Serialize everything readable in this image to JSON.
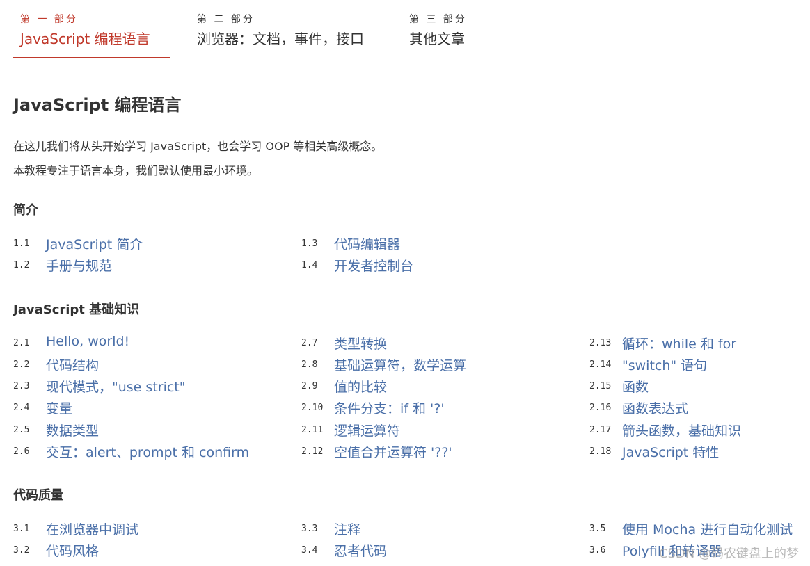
{
  "tabs": [
    {
      "kicker": "第 一 部分",
      "title": "JavaScript 编程语言",
      "active": true
    },
    {
      "kicker": "第 二 部分",
      "title": "浏览器：文档，事件，接口",
      "active": false
    },
    {
      "kicker": "第 三 部分",
      "title": "其他文章",
      "active": false
    }
  ],
  "page": {
    "title": "JavaScript 编程语言",
    "intro": [
      "在这儿我们将从头开始学习 JavaScript，也会学习 OOP 等相关高级概念。",
      "本教程专注于语言本身，我们默认使用最小环境。"
    ]
  },
  "sections": [
    {
      "heading": "简介",
      "items": [
        {
          "num": "1.1",
          "label": "JavaScript 简介"
        },
        {
          "num": "1.2",
          "label": "手册与规范"
        },
        {
          "num": "1.3",
          "label": "代码编辑器"
        },
        {
          "num": "1.4",
          "label": "开发者控制台"
        }
      ]
    },
    {
      "heading": "JavaScript 基础知识",
      "items": [
        {
          "num": "2.1",
          "label": "Hello, world!"
        },
        {
          "num": "2.2",
          "label": "代码结构"
        },
        {
          "num": "2.3",
          "label": "现代模式，\"use strict\""
        },
        {
          "num": "2.4",
          "label": "变量"
        },
        {
          "num": "2.5",
          "label": "数据类型"
        },
        {
          "num": "2.6",
          "label": "交互：alert、prompt 和 confirm"
        },
        {
          "num": "2.7",
          "label": "类型转换"
        },
        {
          "num": "2.8",
          "label": "基础运算符，数学运算"
        },
        {
          "num": "2.9",
          "label": "值的比较"
        },
        {
          "num": "2.10",
          "label": "条件分支：if 和 '?'"
        },
        {
          "num": "2.11",
          "label": "逻辑运算符"
        },
        {
          "num": "2.12",
          "label": "空值合并运算符 '??'"
        },
        {
          "num": "2.13",
          "label": "循环：while 和 for"
        },
        {
          "num": "2.14",
          "label": "\"switch\" 语句"
        },
        {
          "num": "2.15",
          "label": "函数"
        },
        {
          "num": "2.16",
          "label": "函数表达式"
        },
        {
          "num": "2.17",
          "label": "箭头函数，基础知识"
        },
        {
          "num": "2.18",
          "label": "JavaScript 特性"
        }
      ]
    },
    {
      "heading": "代码质量",
      "items": [
        {
          "num": "3.1",
          "label": "在浏览器中调试"
        },
        {
          "num": "3.2",
          "label": "代码风格"
        },
        {
          "num": "3.3",
          "label": "注释"
        },
        {
          "num": "3.4",
          "label": "忍者代码"
        },
        {
          "num": "3.5",
          "label": "使用 Mocha 进行自动化测试"
        },
        {
          "num": "3.6",
          "label": "Polyfill 和转译器"
        }
      ]
    }
  ],
  "watermark": "CSDN @码农键盘上的梦",
  "colors": {
    "accent": "#c0392b",
    "link": "#4a6fa8",
    "text": "#333333"
  }
}
